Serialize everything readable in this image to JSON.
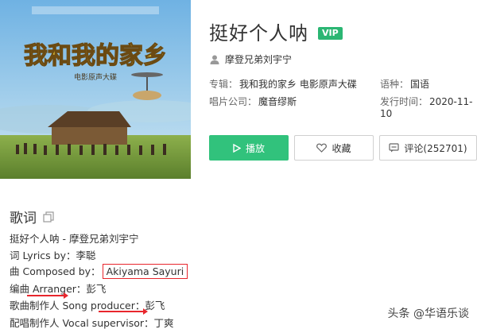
{
  "song": {
    "title": "挺好个人呐",
    "vip_badge": "VIP",
    "singer": "摩登兄弟刘宇宁"
  },
  "album_meta": {
    "album_label": "专辑：",
    "album_value": "我和我的家乡 电影原声大碟",
    "language_label": "语种：",
    "language_value": "国语",
    "company_label": "唱片公司：",
    "company_value": "魔音缪斯",
    "release_label": "发行时间：",
    "release_value": "2020-11-10"
  },
  "actions": {
    "play_label": "播放",
    "favorite_label": "收藏",
    "comment_label": "评论(252701)"
  },
  "cover": {
    "title_text": "我和我的家乡",
    "subtitle_text": "电影原声大碟",
    "sky_color": "#8ec7ea",
    "field_color": "#6f9a3c",
    "title_color": "#f3d23a"
  },
  "lyrics": {
    "heading": "歌词",
    "lines": [
      {
        "text": "挺好个人呐 - 摩登兄弟刘宇宁"
      },
      {
        "text": "词 Lyrics by：李聪"
      },
      {
        "prefix": "曲 Composed by：",
        "boxed": "Akiyama Sayuri"
      },
      {
        "text": "编曲 Arranger：彭飞"
      },
      {
        "text": "歌曲制作人 Song producer：彭飞"
      },
      {
        "text": "配唱制作人 Vocal supervisor：丁爽"
      }
    ]
  },
  "watermark": {
    "text": "头条 @华语乐谈"
  },
  "colors": {
    "accent_green": "#31c27c",
    "annotation_red": "#e8262d"
  }
}
